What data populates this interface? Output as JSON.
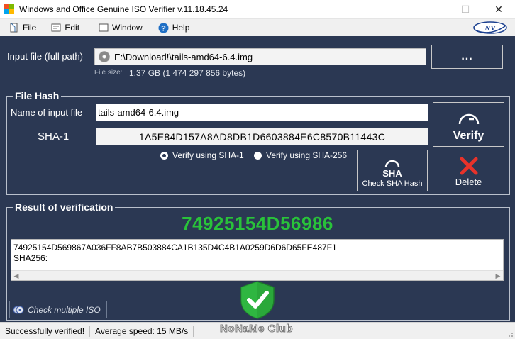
{
  "window": {
    "title": "Windows and Office Genuine ISO Verifier v.11.18.45.24",
    "controls": {
      "minimize": "—",
      "maximize": "☐",
      "close": "✕"
    }
  },
  "menu": {
    "items": [
      {
        "label": "File",
        "icon": "file-icon"
      },
      {
        "label": "Edit",
        "icon": "edit-icon"
      },
      {
        "label": "Window",
        "icon": "window-icon"
      },
      {
        "label": "Help",
        "icon": "help-icon"
      }
    ],
    "logo_text": "NV"
  },
  "input": {
    "label": "Input file (full path)",
    "path": "E:\\Download!\\tails-amd64-6.4.img",
    "browse_label": "...",
    "file_size_label": "File size:",
    "file_size_value": "1,37 GB  (1 474 297 856 bytes)"
  },
  "file_hash": {
    "title": "File Hash",
    "name_label": "Name of input file",
    "name_value": "tails-amd64-6.4.img",
    "sha_label": "SHA-1",
    "sha_value": "1A5E84D157A8AD8DB1D6603884E6C8570B11443C",
    "radio_sha1": "Verify using SHA-1",
    "radio_sha256": "Verify using SHA-256",
    "selected_method": "SHA-1",
    "verify_label": "Verify",
    "check_sha_label": "Check SHA Hash",
    "check_sha_icon_text": "SHA",
    "delete_label": "Delete"
  },
  "result": {
    "title": "Result of verification",
    "code": "74925154D56986",
    "lines": [
      "74925154D569867A036FF8AB7B503884CA1B135D4C4B1A0259D6D6D65FE487F1",
      "SHA256:"
    ]
  },
  "check_multiple_label": "Check multiple ISO",
  "status": {
    "message": "Successfully verified!",
    "speed": "Average speed: 15 MB/s",
    "watermark": "NoNaMe Club"
  },
  "colors": {
    "background": "#2b3853",
    "result_code": "#29c23a",
    "shield": "#2aa83a"
  }
}
